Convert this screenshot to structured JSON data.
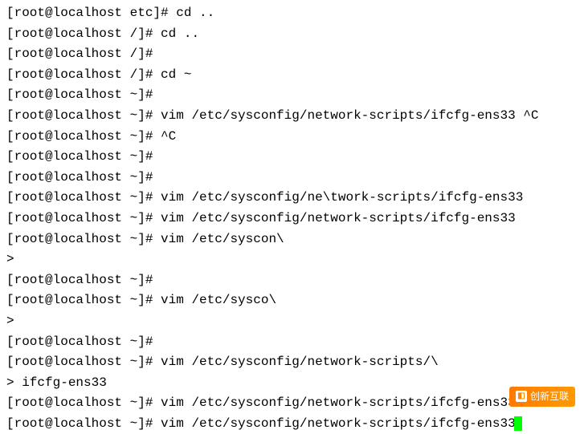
{
  "lines": [
    {
      "prompt": "[root@localhost etc]# ",
      "cmd": "cd .."
    },
    {
      "prompt": "[root@localhost /]# ",
      "cmd": "cd .."
    },
    {
      "prompt": "[root@localhost /]# ",
      "cmd": ""
    },
    {
      "prompt": "[root@localhost /]# ",
      "cmd": "cd ~"
    },
    {
      "prompt": "[root@localhost ~]# ",
      "cmd": ""
    },
    {
      "prompt": "[root@localhost ~]# ",
      "cmd": "vim /etc/sysconfig/network-scripts/ifcfg-ens33 ^C"
    },
    {
      "prompt": "[root@localhost ~]# ",
      "cmd": "^C"
    },
    {
      "prompt": "[root@localhost ~]# ",
      "cmd": ""
    },
    {
      "prompt": "[root@localhost ~]# ",
      "cmd": ""
    },
    {
      "prompt": "[root@localhost ~]# ",
      "cmd": "vim /etc/sysconfig/ne\\twork-scripts/ifcfg-ens33"
    },
    {
      "prompt": "[root@localhost ~]# ",
      "cmd": "vim /etc/sysconfig/network-scripts/ifcfg-ens33"
    },
    {
      "prompt": "[root@localhost ~]# ",
      "cmd": "vim /etc/syscon\\"
    },
    {
      "prompt": "> ",
      "cmd": ""
    },
    {
      "prompt": "[root@localhost ~]# ",
      "cmd": ""
    },
    {
      "prompt": "[root@localhost ~]# ",
      "cmd": "vim /etc/sysco\\"
    },
    {
      "prompt": "> ",
      "cmd": ""
    },
    {
      "prompt": "[root@localhost ~]# ",
      "cmd": ""
    },
    {
      "prompt": "[root@localhost ~]# ",
      "cmd": "vim /etc/sysconfig/network-scripts/\\"
    },
    {
      "prompt": "> ",
      "cmd": "ifcfg-ens33"
    },
    {
      "prompt": "[root@localhost ~]# ",
      "cmd": "vim /etc/sysconfig/network-scripts/ifcfg-ens33"
    },
    {
      "prompt": "[root@localhost ~]# ",
      "cmd": "vim /etc/sysconfig/network-scripts/ifcfg-ens33",
      "cursor": true
    }
  ],
  "watermark": {
    "text": "创新互联"
  }
}
